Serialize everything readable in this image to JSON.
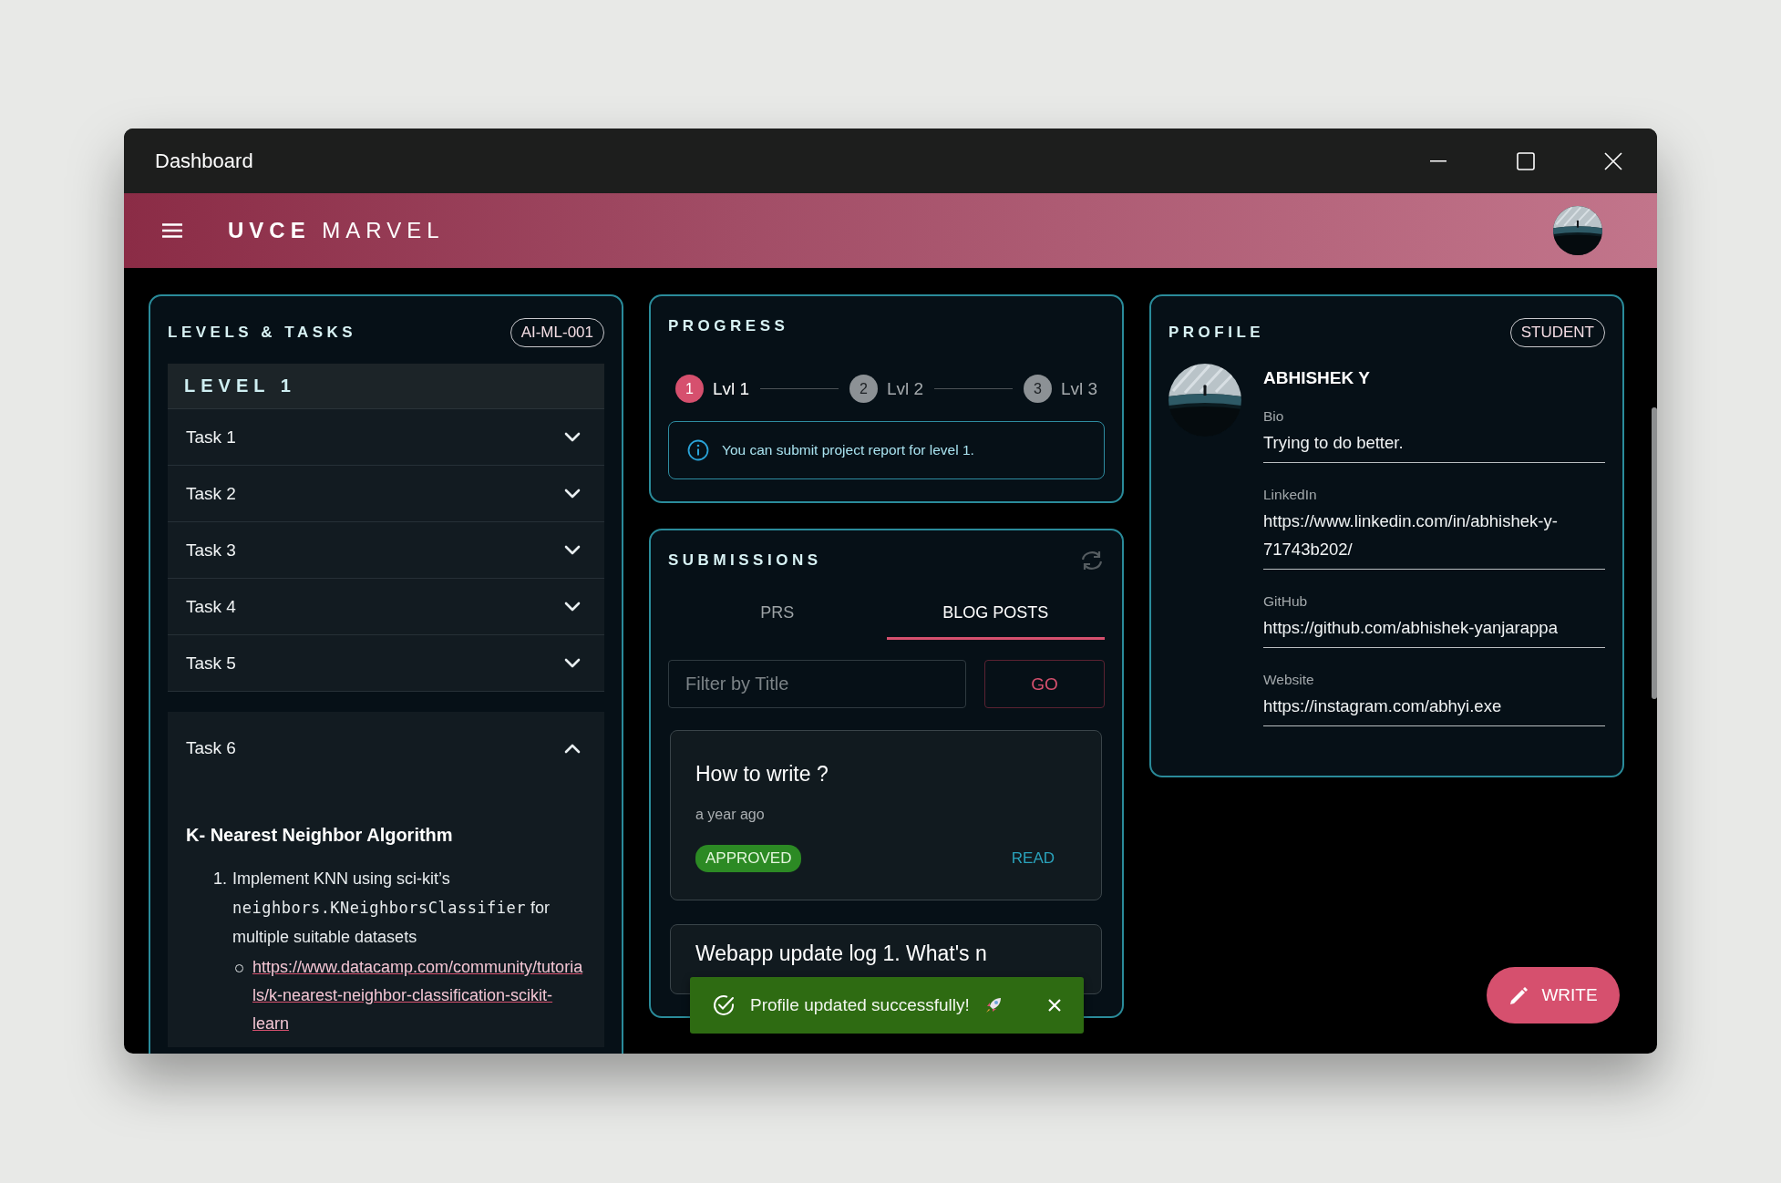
{
  "window": {
    "title": "Dashboard"
  },
  "app_bar": {
    "brand_bold": "UVCE",
    "brand_light": "MARVEL"
  },
  "levels_tasks": {
    "title": "LEVELS & TASKS",
    "badge": "AI-ML-001",
    "level_title": "LEVEL 1",
    "tasks": [
      {
        "label": "Task 1",
        "expanded": false
      },
      {
        "label": "Task 2",
        "expanded": false
      },
      {
        "label": "Task 3",
        "expanded": false
      },
      {
        "label": "Task 4",
        "expanded": false
      },
      {
        "label": "Task 5",
        "expanded": false
      },
      {
        "label": "Task 6",
        "expanded": true,
        "content": {
          "heading": "K- Nearest Neighbor Algorithm",
          "items": [
            {
              "number": "1.",
              "text_before": "Implement KNN using sci-kit’s",
              "code": "neighbors.KNeighborsClassifier",
              "text_after": "for multiple suitable datasets",
              "links": [
                "https://www.datacamp.com/community/tutorials/k-nearest-neighbor-classification-scikit-learn"
              ]
            }
          ]
        }
      }
    ]
  },
  "progress": {
    "title": "PROGRESS",
    "steps": [
      {
        "number": "1",
        "label": "Lvl 1",
        "selected": true
      },
      {
        "number": "2",
        "label": "Lvl 2",
        "selected": false
      },
      {
        "number": "3",
        "label": "Lvl 3",
        "selected": false
      }
    ],
    "info": "You can submit project report for level 1."
  },
  "submissions": {
    "title": "SUBMISSIONS",
    "tabs": [
      {
        "label": "PRS",
        "selected": false
      },
      {
        "label": "BLOG POSTS",
        "selected": true
      }
    ],
    "filter": {
      "placeholder": "Filter by Title"
    },
    "go_button": "GO",
    "posts": [
      {
        "title": "How to write ?",
        "time": "a year ago",
        "status": "APPROVED",
        "action": "READ"
      },
      {
        "title": "Webapp update log 1. What's n"
      }
    ]
  },
  "profile": {
    "title": "PROFILE",
    "role": "STUDENT",
    "name": "ABHISHEK Y",
    "fields": [
      {
        "label": "Bio",
        "value": "Trying to do better."
      },
      {
        "label": "LinkedIn",
        "value": "https://www.linkedin.com/in/abhishek-y-71743b202/"
      },
      {
        "label": "GitHub",
        "value": "https://github.com/abhishek-yanjarappa"
      },
      {
        "label": "Website",
        "value": "https://instagram.com/abhyi.exe"
      }
    ]
  },
  "toast": {
    "message": "Profile updated successfully!"
  },
  "write_button": {
    "label": "WRITE"
  }
}
